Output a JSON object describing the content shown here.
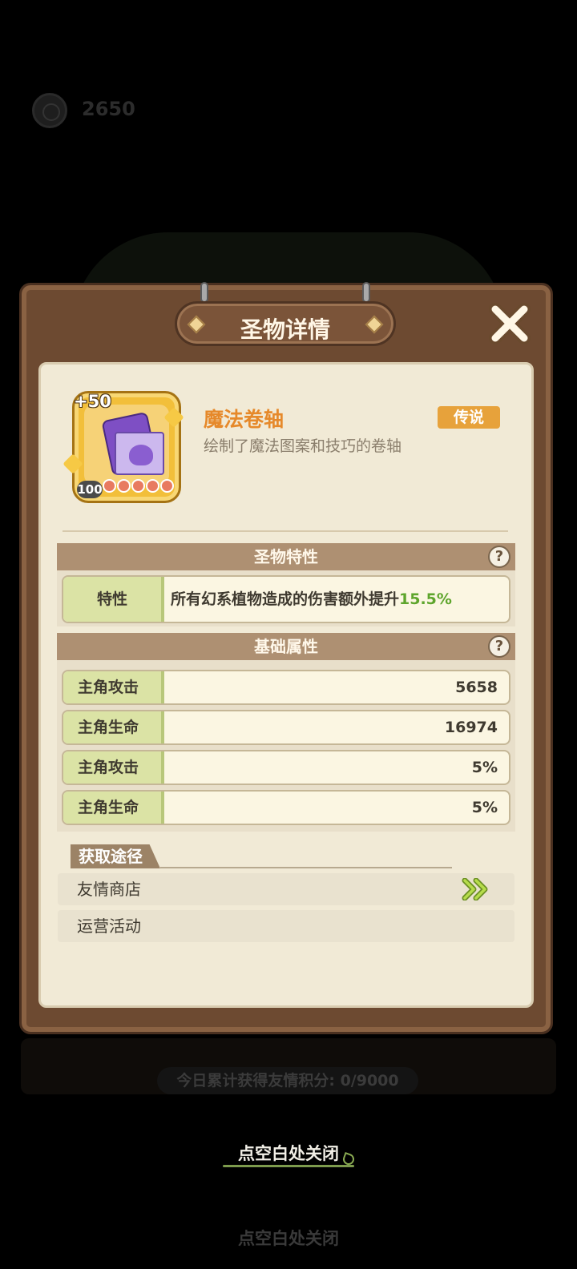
{
  "background": {
    "coin_count": "2650",
    "daily_points": "今日累计获得友情积分: 0/9000",
    "close_hint": "点空白处关闭"
  },
  "dialog": {
    "title": "圣物详情",
    "item": {
      "name": "魔法卷轴",
      "description": "绘制了魔法图案和技巧的卷轴",
      "rarity": "传说",
      "enhance": "+50",
      "level": "100",
      "stars": 5
    },
    "trait_section": {
      "header": "圣物特性",
      "label": "特性",
      "text": "所有幻系植物造成的伤害额外提升",
      "value": "15.5%"
    },
    "attr_section": {
      "header": "基础属性",
      "rows": [
        {
          "label": "主角攻击",
          "value": "5658"
        },
        {
          "label": "主角生命",
          "value": "16974"
        },
        {
          "label": "主角攻击",
          "value": "5%"
        },
        {
          "label": "主角生命",
          "value": "5%"
        }
      ]
    },
    "sources": {
      "header": "获取途径",
      "items": [
        {
          "label": "友情商店",
          "has_link": true
        },
        {
          "label": "运营活动",
          "has_link": false
        }
      ]
    }
  },
  "colors": {
    "accent": "#e6892a",
    "highlight": "#5ea52c",
    "rarity": "#e7a23b"
  }
}
